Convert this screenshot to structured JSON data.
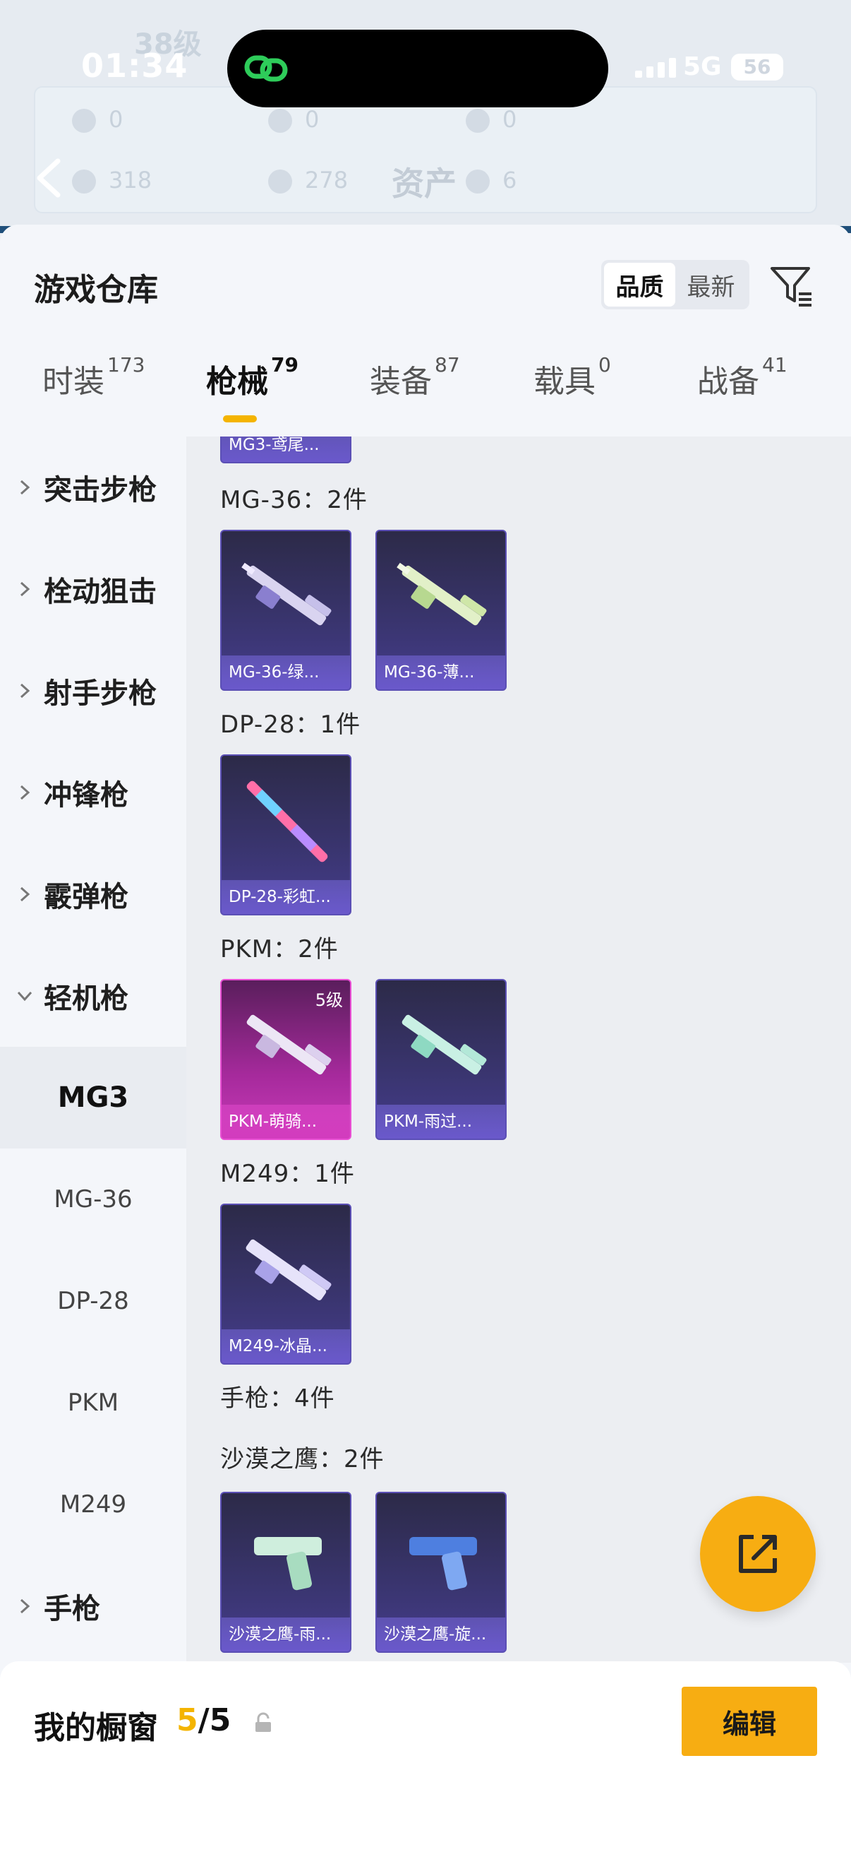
{
  "status_bar": {
    "time": "01:34",
    "network": "5G",
    "battery": "56"
  },
  "backdrop": {
    "title": "资产",
    "level_text": "38级",
    "stats_row1": [
      "0",
      "0",
      "0"
    ],
    "stats_row2": [
      "318",
      "278",
      "6"
    ]
  },
  "header": {
    "title": "游戏仓库",
    "sort_options": [
      "品质",
      "最新"
    ],
    "active_sort": "品质"
  },
  "tabs": [
    {
      "label": "时装",
      "count": "173"
    },
    {
      "label": "枪械",
      "count": "79",
      "active": true
    },
    {
      "label": "装备",
      "count": "87"
    },
    {
      "label": "载具",
      "count": "0"
    },
    {
      "label": "战备",
      "count": "41"
    }
  ],
  "sidebar": {
    "categories": [
      "突击步枪",
      "栓动狙击",
      "射手步枪",
      "冲锋枪",
      "霰弹枪",
      "轻机枪"
    ],
    "expanded": "轻机枪",
    "subitems": [
      "MG3",
      "MG-36",
      "DP-28",
      "PKM",
      "M249"
    ],
    "active_sub": "MG3",
    "last_category": "手枪"
  },
  "content": {
    "partial_card_name": "MG3-鸢尾...",
    "groups": [
      {
        "title": "MG-36：2件",
        "items": [
          {
            "name": "MG-36-绿..."
          },
          {
            "name": "MG-36-薄..."
          }
        ]
      },
      {
        "title": "DP-28：1件",
        "items": [
          {
            "name": "DP-28-彩虹..."
          }
        ]
      },
      {
        "title": "PKM：2件",
        "items": [
          {
            "name": "PKM-萌骑...",
            "level": "5级",
            "rarity": "pink"
          },
          {
            "name": "PKM-雨过..."
          }
        ]
      },
      {
        "title": "M249：1件",
        "items": [
          {
            "name": "M249-冰晶..."
          }
        ]
      }
    ],
    "section_title": "手枪：4件",
    "pistol_group": {
      "title": "沙漠之鹰：2件",
      "items": [
        {
          "name": "沙漠之鹰-雨..."
        },
        {
          "name": "沙漠之鹰-旋..."
        }
      ]
    }
  },
  "bottom_bar": {
    "label": "我的橱窗",
    "count_current": "5",
    "count_sep": "/",
    "count_total": "5",
    "edit_label": "编辑"
  },
  "colors": {
    "accent": "#f4b400",
    "fab": "#f7ad12",
    "card_purple": "#3a3570",
    "card_pink": "#c83ab8"
  }
}
